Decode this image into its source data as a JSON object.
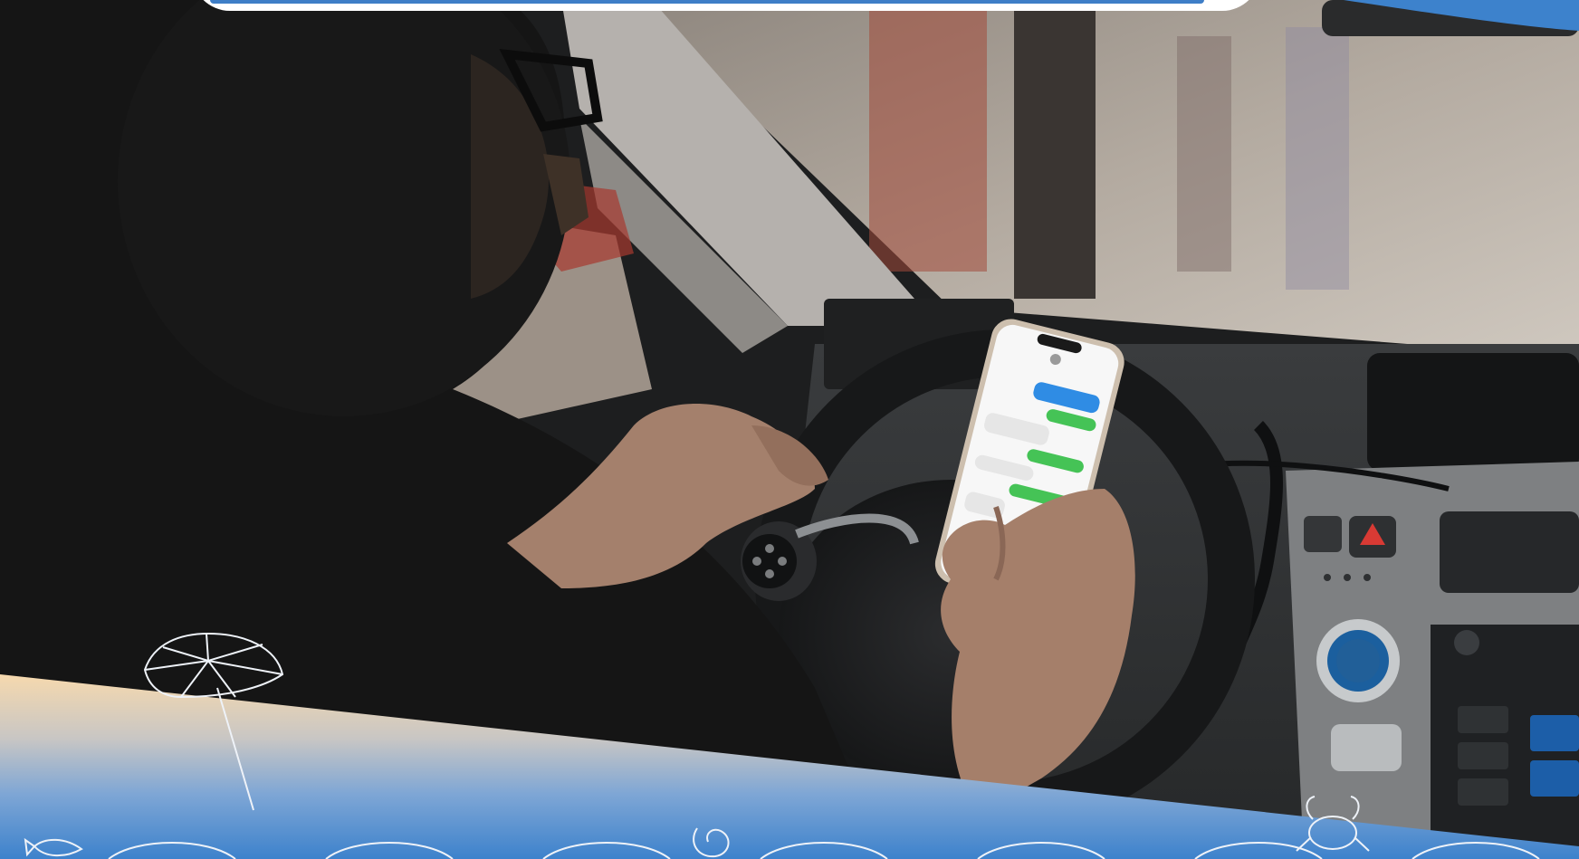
{
  "scene": {
    "subject": "driver-texting-on-phone",
    "icons": [
      "beach-umbrella-icon",
      "seashell-icon",
      "crab-icon",
      "fish-icon"
    ]
  },
  "colors": {
    "band_top": "#f6d9ae",
    "band_bottom": "#3d82cc",
    "header_strip": "#3e7ec7",
    "bubble_blue": "#2f8ce4",
    "bubble_green": "#45c356",
    "line_art": "#eef2f8"
  }
}
